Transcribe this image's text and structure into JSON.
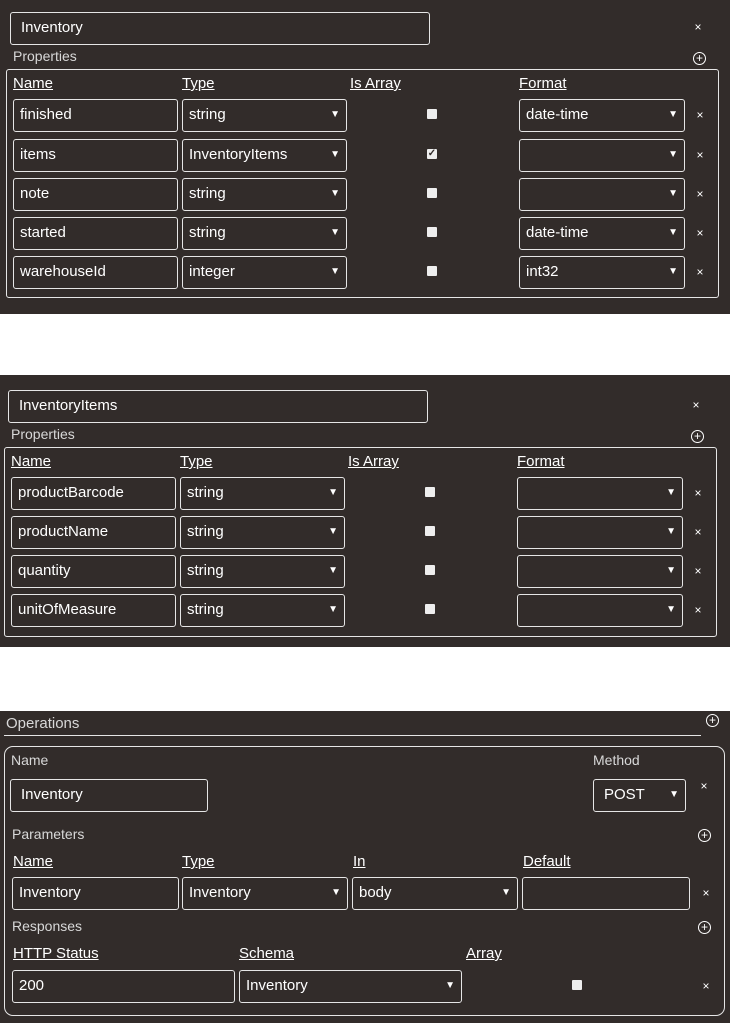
{
  "models": [
    {
      "name": "Inventory",
      "properties_label": "Properties",
      "headers": {
        "name": "Name",
        "type": "Type",
        "is_array": "Is Array",
        "format": "Format"
      },
      "properties": [
        {
          "name": "finished",
          "type": "string",
          "is_array": false,
          "format": "date-time"
        },
        {
          "name": "items",
          "type": "InventoryItems",
          "is_array": true,
          "format": ""
        },
        {
          "name": "note",
          "type": "string",
          "is_array": false,
          "format": ""
        },
        {
          "name": "started",
          "type": "string",
          "is_array": false,
          "format": "date-time"
        },
        {
          "name": "warehouseId",
          "type": "integer",
          "is_array": false,
          "format": "int32"
        }
      ]
    },
    {
      "name": "InventoryItems",
      "properties_label": "Properties",
      "headers": {
        "name": "Name",
        "type": "Type",
        "is_array": "Is Array",
        "format": "Format"
      },
      "properties": [
        {
          "name": "productBarcode",
          "type": "string",
          "is_array": false,
          "format": ""
        },
        {
          "name": "productName",
          "type": "string",
          "is_array": false,
          "format": ""
        },
        {
          "name": "quantity",
          "type": "string",
          "is_array": false,
          "format": ""
        },
        {
          "name": "unitOfMeasure",
          "type": "string",
          "is_array": false,
          "format": ""
        }
      ]
    }
  ],
  "operations": {
    "label": "Operations",
    "name_label": "Name",
    "method_label": "Method",
    "name": "Inventory",
    "method": "POST",
    "parameters_label": "Parameters",
    "param_headers": {
      "name": "Name",
      "type": "Type",
      "in": "In",
      "default": "Default"
    },
    "parameter": {
      "name": "Inventory",
      "type": "Inventory",
      "in": "body",
      "default": ""
    },
    "responses_label": "Responses",
    "resp_headers": {
      "status": "HTTP Status",
      "schema": "Schema",
      "array": "Array"
    },
    "response": {
      "status": "200",
      "schema": "Inventory",
      "array": false
    }
  },
  "icons": {
    "close": "×",
    "add": "+",
    "dropdown": "▼",
    "check": "✓"
  }
}
